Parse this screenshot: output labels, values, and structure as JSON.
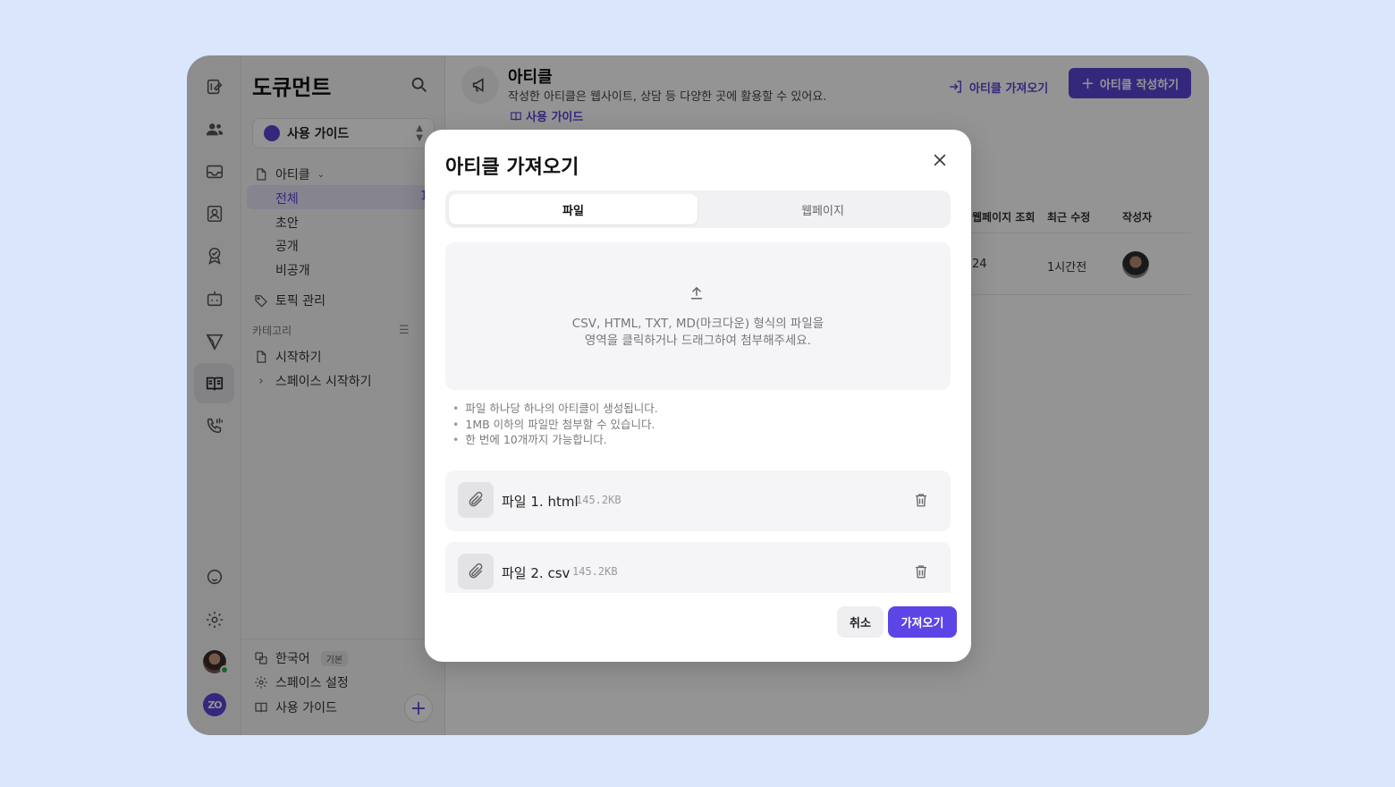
{
  "sidebar": {
    "title": "도큐먼트",
    "guide_select": "사용 가이드",
    "articles_label": "아티클",
    "articles_sub": [
      "전체",
      "초안",
      "공개",
      "비공개"
    ],
    "all_count": "1",
    "topic_manage": "토픽 관리",
    "category_label": "카테고리",
    "categories": [
      "시작하기",
      "스페이스 시작하기"
    ],
    "language": "한국어",
    "language_badge": "기본",
    "space_settings": "스페이스 설정",
    "user_guide": "사용 가이드"
  },
  "rail": {
    "brand": "ZO",
    "icons": [
      "doc-edit-icon",
      "contacts-icon",
      "inbox-icon",
      "profile-card-icon",
      "badge-icon",
      "bot-icon",
      "send-icon",
      "book-icon",
      "phone-icon",
      "help-icon",
      "settings-icon"
    ]
  },
  "header": {
    "title": "아티클",
    "description": "작성한 아티클은 웹사이트, 상담 등 다양한 곳에 활용할 수 있어요.",
    "guide_link": "사용 가이드",
    "import_button": "아티클 가져오기",
    "write_button": "아티클 작성하기"
  },
  "table": {
    "columns": [
      "웹페이지 조회",
      "최근 수정",
      "작성자"
    ],
    "rows": [
      {
        "views": "24",
        "updated": "1시간전"
      }
    ]
  },
  "modal": {
    "title": "아티클 가져오기",
    "tabs": [
      "파일",
      "웹페이지"
    ],
    "active_tab": "파일",
    "drop_line1": "CSV, HTML, TXT, MD(마크다운) 형식의 파일을",
    "drop_line2": "영역을 클릭하거나 드래그하여 첨부해주세요.",
    "notes": [
      "파일 하나당 하나의 아티클이 생성됩니다.",
      "1MB 이하의 파일만 첨부할 수 있습니다.",
      "한 번에 10개까지 가능합니다."
    ],
    "files": [
      {
        "name": "파일 1. html",
        "size": "145.2KB"
      },
      {
        "name": "파일 2. csv",
        "size": "145.2KB"
      }
    ],
    "cancel": "취소",
    "confirm": "가져오기"
  },
  "colors": {
    "accent": "#5b45d8",
    "background": "#d9e6fc"
  }
}
